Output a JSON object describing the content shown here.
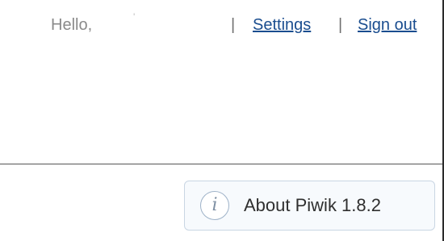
{
  "header": {
    "greeting": "Hello,",
    "username": "'",
    "separator": "|",
    "settings_label": "Settings",
    "signout_label": "Sign out"
  },
  "footer": {
    "about_label": "About Piwik 1.8.2",
    "info_icon_glyph": "i"
  },
  "colors": {
    "link": "#1a4d8f",
    "greeting": "#8a8a8a",
    "about_background": "#f7fafd",
    "about_border": "#c9d6e3"
  }
}
